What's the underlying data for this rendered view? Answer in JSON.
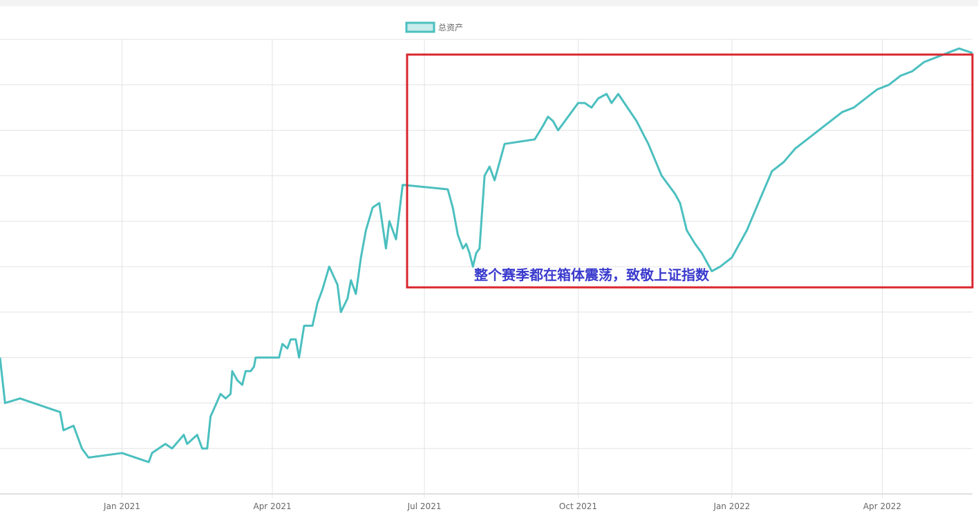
{
  "colors": {
    "series_line": "#4bbfbf",
    "legend_fill": "#c8ebeb",
    "grid": "#e3e3e3",
    "highlight_box": "#d9262e",
    "annotation_text": "#3a3acd"
  },
  "annotation": {
    "text": "整个赛季都在箱体震荡，致敬上证指数"
  },
  "chart_data": {
    "type": "line",
    "title": "",
    "xlabel": "",
    "ylabel": "",
    "x_range": [
      "2020-10-20",
      "2022-05-25"
    ],
    "y_range": [
      0,
      100
    ],
    "y_axis_labels_visible": false,
    "grid": true,
    "legend": {
      "placement": "top-center",
      "entries": [
        "总资产"
      ]
    },
    "x_ticks": [
      {
        "date": "2021-01-01",
        "label": "Jan 2021"
      },
      {
        "date": "2021-04-01",
        "label": "Apr 2021"
      },
      {
        "date": "2021-07-01",
        "label": "Jul 2021"
      },
      {
        "date": "2021-10-01",
        "label": "Oct 2021"
      },
      {
        "date": "2022-01-01",
        "label": "Jan 2022"
      },
      {
        "date": "2022-04-01",
        "label": "Apr 2022"
      }
    ],
    "series": [
      {
        "name": "总资产",
        "points": [
          [
            "2020-10-20",
            30
          ],
          [
            "2020-10-23",
            20
          ],
          [
            "2020-11-01",
            21
          ],
          [
            "2020-11-25",
            18
          ],
          [
            "2020-11-27",
            14
          ],
          [
            "2020-12-03",
            15
          ],
          [
            "2020-12-08",
            10
          ],
          [
            "2020-12-12",
            8
          ],
          [
            "2021-01-01",
            9
          ],
          [
            "2021-01-17",
            7
          ],
          [
            "2021-01-19",
            9
          ],
          [
            "2021-01-27",
            11
          ],
          [
            "2021-01-31",
            10
          ],
          [
            "2021-02-07",
            13
          ],
          [
            "2021-02-09",
            11
          ],
          [
            "2021-02-15",
            13
          ],
          [
            "2021-02-18",
            10
          ],
          [
            "2021-02-21",
            10
          ],
          [
            "2021-02-23",
            17
          ],
          [
            "2021-03-01",
            22
          ],
          [
            "2021-03-04",
            21
          ],
          [
            "2021-03-07",
            22
          ],
          [
            "2021-03-08",
            27
          ],
          [
            "2021-03-11",
            25
          ],
          [
            "2021-03-14",
            24
          ],
          [
            "2021-03-16",
            27
          ],
          [
            "2021-03-19",
            27
          ],
          [
            "2021-03-21",
            28
          ],
          [
            "2021-03-22",
            30
          ],
          [
            "2021-04-05",
            30
          ],
          [
            "2021-04-07",
            33
          ],
          [
            "2021-04-10",
            32
          ],
          [
            "2021-04-12",
            34
          ],
          [
            "2021-04-15",
            34
          ],
          [
            "2021-04-17",
            30
          ],
          [
            "2021-04-20",
            37
          ],
          [
            "2021-04-25",
            37
          ],
          [
            "2021-04-28",
            42
          ],
          [
            "2021-05-01",
            45
          ],
          [
            "2021-05-05",
            50
          ],
          [
            "2021-05-10",
            46
          ],
          [
            "2021-05-12",
            40
          ],
          [
            "2021-05-16",
            43
          ],
          [
            "2021-05-18",
            47
          ],
          [
            "2021-05-21",
            44
          ],
          [
            "2021-05-24",
            52
          ],
          [
            "2021-05-27",
            58
          ],
          [
            "2021-05-31",
            63
          ],
          [
            "2021-06-04",
            64
          ],
          [
            "2021-06-08",
            54
          ],
          [
            "2021-06-10",
            60
          ],
          [
            "2021-06-14",
            56
          ],
          [
            "2021-06-18",
            68
          ],
          [
            "2021-07-15",
            67
          ],
          [
            "2021-07-18",
            63
          ],
          [
            "2021-07-21",
            57
          ],
          [
            "2021-07-24",
            54
          ],
          [
            "2021-07-26",
            55
          ],
          [
            "2021-07-28",
            53
          ],
          [
            "2021-07-30",
            50
          ],
          [
            "2021-08-01",
            53
          ],
          [
            "2021-08-03",
            54
          ],
          [
            "2021-08-06",
            70
          ],
          [
            "2021-08-09",
            72
          ],
          [
            "2021-08-12",
            69
          ],
          [
            "2021-08-18",
            77
          ],
          [
            "2021-09-05",
            78
          ],
          [
            "2021-09-10",
            81
          ],
          [
            "2021-09-13",
            83
          ],
          [
            "2021-09-16",
            82
          ],
          [
            "2021-09-19",
            80
          ],
          [
            "2021-10-01",
            86
          ],
          [
            "2021-10-05",
            86
          ],
          [
            "2021-10-09",
            85
          ],
          [
            "2021-10-13",
            87
          ],
          [
            "2021-10-18",
            88
          ],
          [
            "2021-10-21",
            86
          ],
          [
            "2021-10-25",
            88
          ],
          [
            "2021-11-05",
            82
          ],
          [
            "2021-11-12",
            77
          ],
          [
            "2021-11-20",
            70
          ],
          [
            "2021-11-28",
            66
          ],
          [
            "2021-12-01",
            64
          ],
          [
            "2021-12-05",
            58
          ],
          [
            "2021-12-10",
            55
          ],
          [
            "2021-12-14",
            53
          ],
          [
            "2021-12-20",
            49
          ],
          [
            "2021-12-25",
            50
          ],
          [
            "2022-01-01",
            52
          ],
          [
            "2022-01-10",
            58
          ],
          [
            "2022-01-18",
            65
          ],
          [
            "2022-01-25",
            71
          ],
          [
            "2022-02-01",
            73
          ],
          [
            "2022-02-08",
            76
          ],
          [
            "2022-02-15",
            78
          ],
          [
            "2022-02-22",
            80
          ],
          [
            "2022-03-01",
            82
          ],
          [
            "2022-03-08",
            84
          ],
          [
            "2022-03-15",
            85
          ],
          [
            "2022-03-22",
            87
          ],
          [
            "2022-03-29",
            89
          ],
          [
            "2022-04-05",
            90
          ],
          [
            "2022-04-12",
            92
          ],
          [
            "2022-04-19",
            93
          ],
          [
            "2022-04-26",
            95
          ],
          [
            "2022-05-03",
            96
          ],
          [
            "2022-05-10",
            97
          ],
          [
            "2022-05-17",
            98
          ],
          [
            "2022-05-25",
            97
          ]
        ]
      }
    ]
  }
}
